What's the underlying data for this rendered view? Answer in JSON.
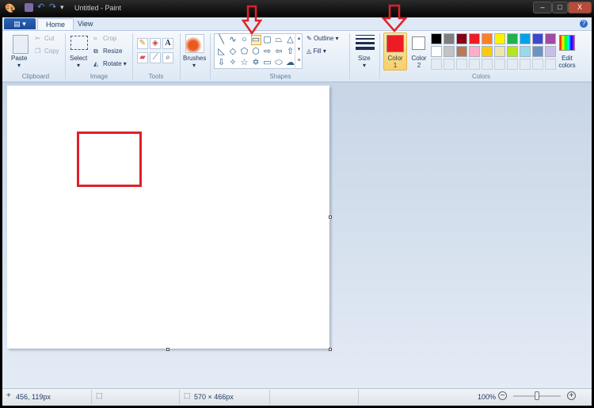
{
  "window": {
    "title": "Untitled - Paint",
    "minimize": "–",
    "maximize": "□",
    "close": "X"
  },
  "tabs": [
    {
      "label": "Home",
      "active": true
    },
    {
      "label": "View"
    }
  ],
  "file_menu_icon": "file-menu-icon",
  "clipboard": {
    "paste": "Paste",
    "cut": "Cut",
    "copy": "Copy",
    "group": "Clipboard"
  },
  "image": {
    "select": "Select",
    "crop": "Crop",
    "resize": "Resize",
    "rotate": "Rotate",
    "group": "Image"
  },
  "tools": {
    "group": "Tools",
    "items": [
      "pencil-icon",
      "fill-icon",
      "text-icon",
      "eraser-icon",
      "color-picker-icon",
      "magnifier-icon"
    ],
    "text_glyph": "A"
  },
  "brushes": {
    "label": "Brushes"
  },
  "shapes": {
    "group": "Shapes",
    "outline": "Outline",
    "fill": "Fill",
    "selected": "rectangle",
    "items": [
      "╲",
      "∿",
      "○",
      "▭",
      "▢",
      "⏢",
      "△",
      "◺",
      "◇",
      "⬠",
      "⬡",
      "⇨",
      "⇦",
      "⇧",
      "⇩",
      "✧",
      "☆",
      "✡",
      "▭",
      "⬭",
      "☁"
    ]
  },
  "size": {
    "label": "Size"
  },
  "colors": {
    "group": "Colors",
    "color1_label": "Color",
    "color1_num": "1",
    "color2_label": "Color",
    "color2_num": "2",
    "color1": "#ed1c24",
    "color2": "#ffffff",
    "edit": "Edit",
    "edit2": "colors",
    "palette": [
      "#000000",
      "#7f7f7f",
      "#880015",
      "#ed1c24",
      "#ff7f27",
      "#fff200",
      "#22b14c",
      "#00a2e8",
      "#3f48cc",
      "#a349a4",
      "#ffffff",
      "#c3c3c3",
      "#b97a57",
      "#ffaec9",
      "#ffc90e",
      "#efe4b0",
      "#b5e61d",
      "#99d9ea",
      "#7092be",
      "#c8bfe7"
    ]
  },
  "canvas": {
    "shape_color": "#e0202a"
  },
  "annotation_color": "#e0202a",
  "status": {
    "cursor": "456, 119px",
    "size": "570 × 466px",
    "zoom": "100%",
    "zoom_level": 100
  }
}
